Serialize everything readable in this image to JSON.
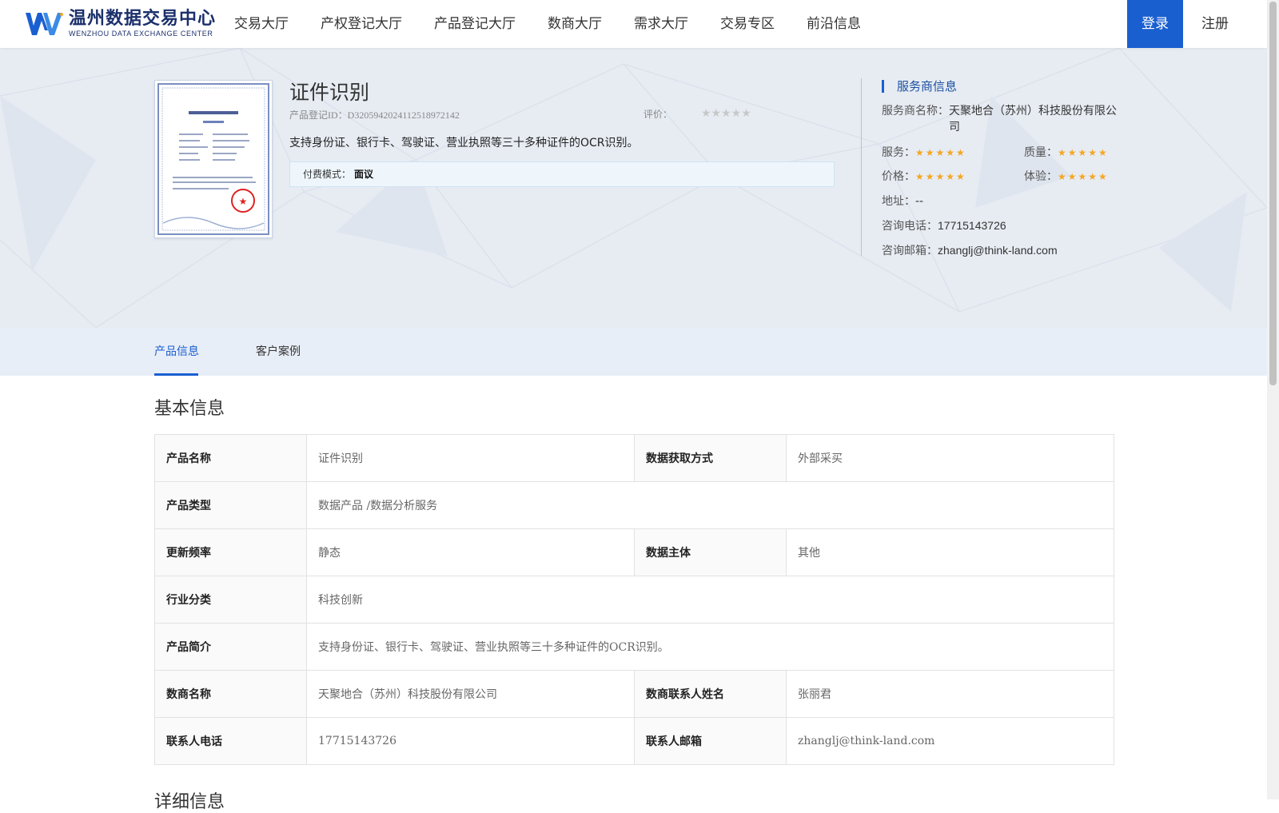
{
  "header": {
    "logo_cn": "温州数据交易中心",
    "logo_en": "WENZHOU DATA EXCHANGE CENTER",
    "nav": [
      "交易大厅",
      "产权登记大厅",
      "产品登记大厅",
      "数商大厅",
      "需求大厅",
      "交易专区",
      "前沿信息"
    ],
    "login": "登录",
    "register": "注册"
  },
  "product": {
    "title": "证件识别",
    "id_label": "产品登记ID：",
    "id_value": "D3205942024112518972142",
    "rating_label": "评价：",
    "rating_stars": "★★★★★",
    "rating_value": 0,
    "description": "支持身份证、银行卡、驾驶证、营业执照等三十多种证件的OCR识别。",
    "fee_label": "付费模式：",
    "fee_value": "面议"
  },
  "provider": {
    "section_title": "服务商信息",
    "name_label": "服务商名称：",
    "name_value": "天聚地合（苏州）科技股份有限公司",
    "service_label": "服务：",
    "quality_label": "质量：",
    "price_label": "价格：",
    "experience_label": "体验：",
    "stars": "★★★★★",
    "address_label": "地址：",
    "address_value": "--",
    "phone_label": "咨询电话：",
    "phone_value": "17715143726",
    "email_label": "咨询邮箱：",
    "email_value": "zhanglj@think-land.com"
  },
  "tabs": [
    "产品信息",
    "客户案例"
  ],
  "basic_info": {
    "title": "基本信息",
    "product_name_label": "产品名称",
    "product_name": "证件识别",
    "data_source_label": "数据获取方式",
    "data_source": "外部采买",
    "product_type_label": "产品类型",
    "product_type": "数据产品 /数据分析服务",
    "update_freq_label": "更新频率",
    "update_freq": "静态",
    "data_subject_label": "数据主体",
    "data_subject": "其他",
    "industry_label": "行业分类",
    "industry": "科技创新",
    "intro_label": "产品简介",
    "intro": "支持身份证、银行卡、驾驶证、营业执照等三十多种证件的OCR识别。",
    "merchant_label": "数商名称",
    "merchant": "天聚地合（苏州）科技股份有限公司",
    "contact_name_label": "数商联系人姓名",
    "contact_name": "张丽君",
    "contact_phone_label": "联系人电话",
    "contact_phone": "17715143726",
    "contact_email_label": "联系人邮箱",
    "contact_email": "zhanglj@think-land.com"
  },
  "detail_title": "详细信息",
  "colors": {
    "primary": "#1a5fd0",
    "star": "#f5a623",
    "hero_bg": "#e7ecf3"
  }
}
